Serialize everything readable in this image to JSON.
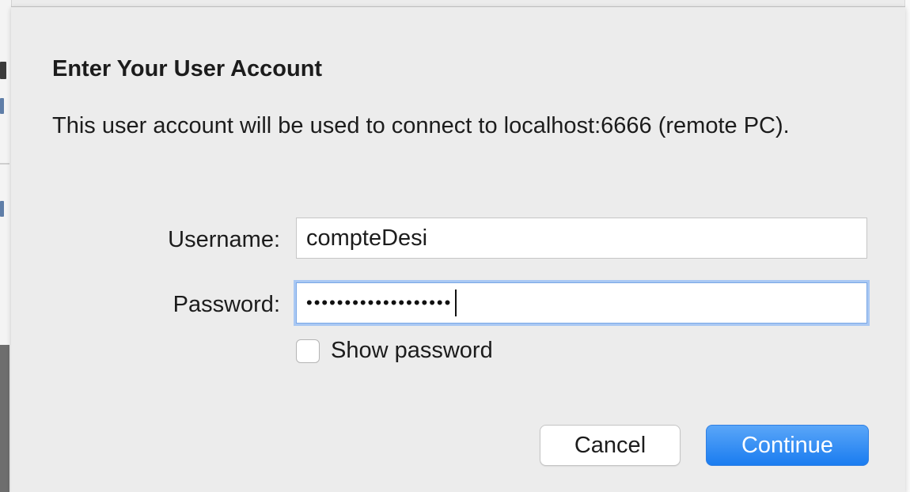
{
  "dialog": {
    "title": "Enter Your User Account",
    "message": "This user account will be used to connect to localhost:6666 (remote PC)."
  },
  "form": {
    "username_label": "Username:",
    "username_value": "compteDesi",
    "password_label": "Password:",
    "password_masked": "•••••••••••••••••••",
    "show_password_label": "Show password",
    "show_password_checked": false
  },
  "buttons": {
    "cancel_label": "Cancel",
    "continue_label": "Continue"
  },
  "colors": {
    "accent": "#1a7cf0",
    "focus_ring": "#a9c8f3",
    "sheet_background": "#ececec"
  }
}
